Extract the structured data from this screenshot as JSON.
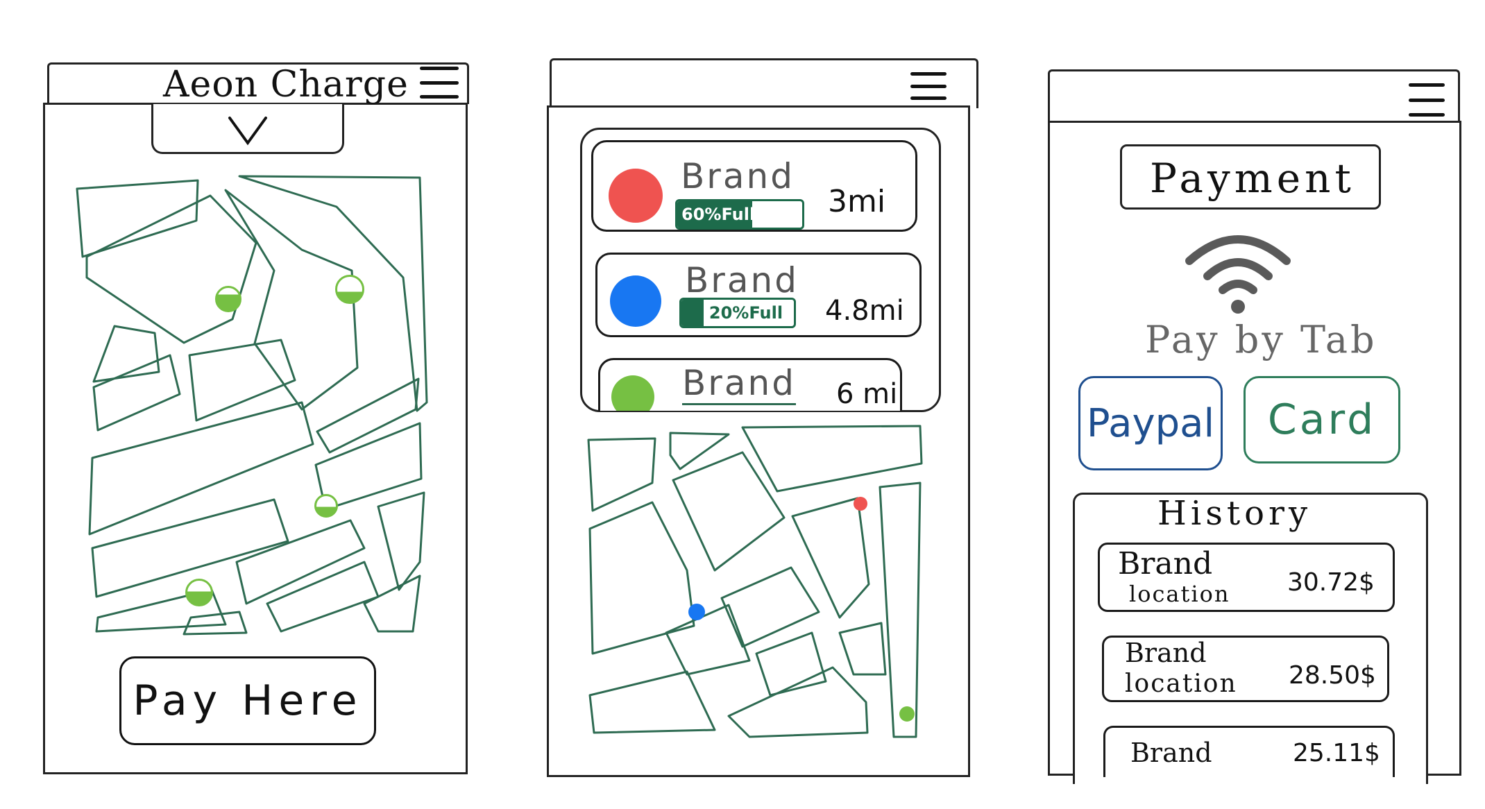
{
  "screen1": {
    "app_title": "Aeon Charge",
    "dropdown_icon": "chevron-down-icon",
    "menu_icon": "hamburger-menu-icon",
    "pay_button_label": "Pay Here",
    "marker_icon": "charging-station-marker-icon"
  },
  "screen2": {
    "menu_icon": "hamburger-menu-icon",
    "stations": [
      {
        "brand": "Brand",
        "charge_label": "60%Full",
        "charge_fraction": 0.6,
        "distance": "3mi",
        "dot_color": "#ef5350"
      },
      {
        "brand": "Brand",
        "charge_label": "20%Full",
        "charge_fraction": 0.2,
        "distance": "4.8mi",
        "dot_color": "#1877f2"
      },
      {
        "brand": "Brand",
        "distance": "6 mi",
        "dot_color": "#76c043"
      }
    ]
  },
  "screen3": {
    "menu_icon": "hamburger-menu-icon",
    "payment_title": "Payment",
    "tap_icon": "contactless-pay-icon",
    "pay_by_tap_label": "Pay by Tab",
    "paypal_label": "Paypal",
    "card_label": "Card",
    "history_title": "History",
    "history": [
      {
        "brand": "Brand",
        "location": "location",
        "amount": "30.72$"
      },
      {
        "brand": "Brand",
        "location": "location",
        "amount": "28.50$"
      },
      {
        "brand": "Brand",
        "amount": "25.11$"
      }
    ]
  },
  "colors": {
    "map_line": "#2e6b52",
    "marker_green": "#76c043",
    "bar_green": "#1d6b4b",
    "paypal_blue": "#1f4f8f",
    "card_green": "#2e7d5b",
    "tap_gray": "#5a5a5a"
  }
}
